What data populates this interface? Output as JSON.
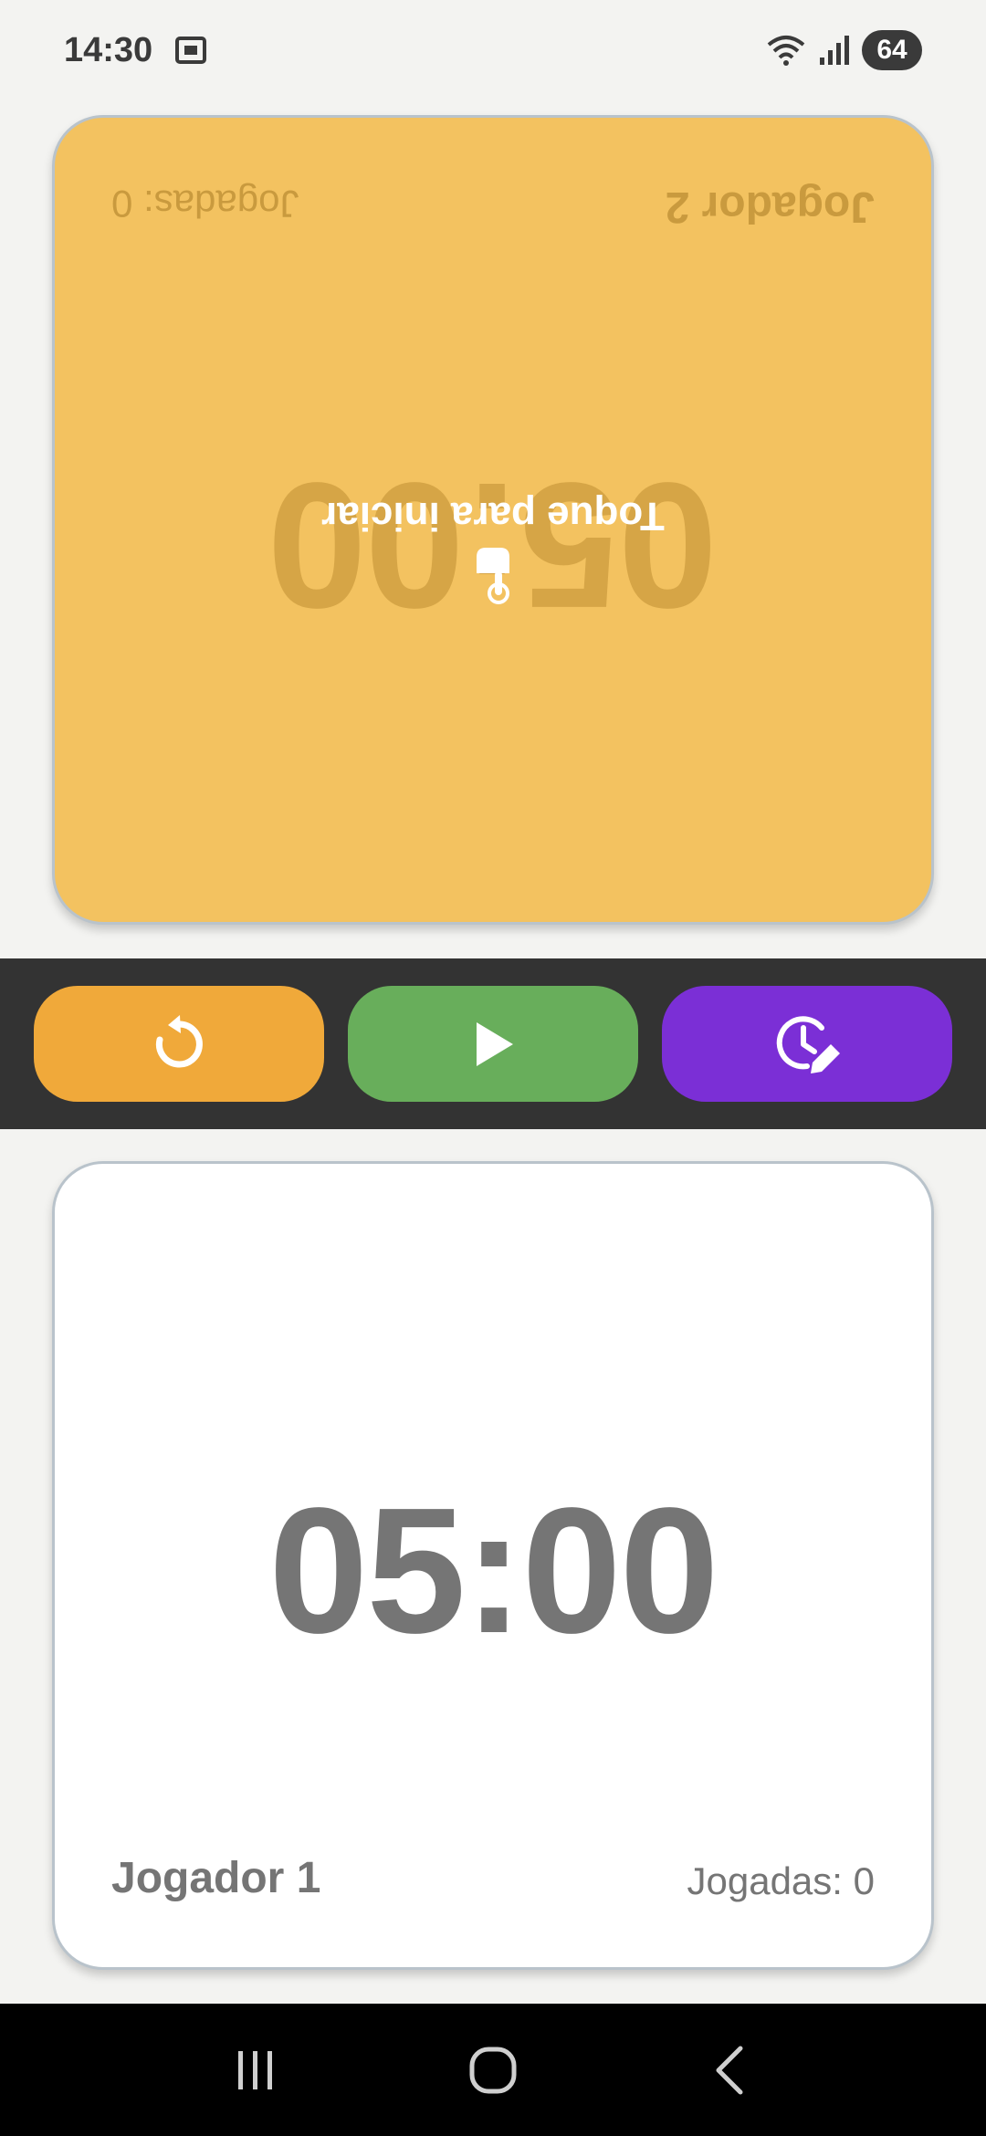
{
  "status_bar": {
    "time": "14:30",
    "battery": "64",
    "icons": [
      "screenshot-icon",
      "wifi-icon",
      "signal-icon"
    ]
  },
  "player2": {
    "name": "Jogador 2",
    "moves": "Jogadas: 0",
    "time": "05:00",
    "hint": "Toque para iniciar",
    "rotated": true,
    "color": "#f3c260"
  },
  "player1": {
    "name": "Jogador 1",
    "moves": "Jogadas: 0",
    "time": "05:00",
    "color": "#ffffff"
  },
  "controls": {
    "reset": {
      "icon": "reset-icon",
      "color": "#f0a93a"
    },
    "play": {
      "icon": "play-icon",
      "color": "#68ae5b"
    },
    "time_settings": {
      "icon": "clock-edit-icon",
      "color": "#7b2fd6"
    }
  },
  "nav_bar": {
    "items": [
      "recent-apps-icon",
      "home-icon",
      "back-icon"
    ]
  }
}
